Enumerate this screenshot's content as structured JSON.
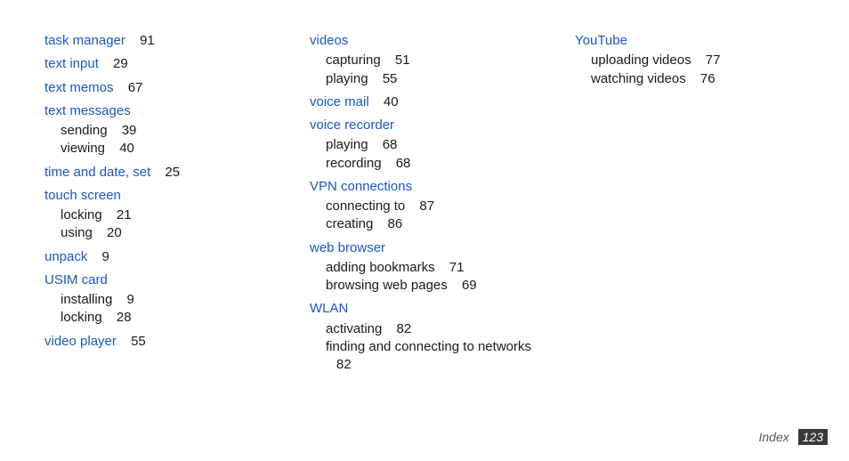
{
  "columns": [
    {
      "entries": [
        {
          "term": "task manager",
          "page": "91"
        },
        {
          "term": "text input",
          "page": "29"
        },
        {
          "term": "text memos",
          "page": "67"
        },
        {
          "term": "text messages",
          "subs": [
            {
              "label": "sending",
              "page": "39"
            },
            {
              "label": "viewing",
              "page": "40"
            }
          ]
        },
        {
          "term": "time and date, set",
          "page": "25"
        },
        {
          "term": "touch screen",
          "subs": [
            {
              "label": "locking",
              "page": "21"
            },
            {
              "label": "using",
              "page": "20"
            }
          ]
        },
        {
          "term": "unpack",
          "page": "9"
        },
        {
          "term": "USIM card",
          "subs": [
            {
              "label": "installing",
              "page": "9"
            },
            {
              "label": "locking",
              "page": "28"
            }
          ]
        },
        {
          "term": "video player",
          "page": "55"
        }
      ]
    },
    {
      "entries": [
        {
          "term": "videos",
          "subs": [
            {
              "label": "capturing",
              "page": "51"
            },
            {
              "label": "playing",
              "page": "55"
            }
          ]
        },
        {
          "term": "voice mail",
          "page": "40"
        },
        {
          "term": "voice recorder",
          "subs": [
            {
              "label": "playing",
              "page": "68"
            },
            {
              "label": "recording",
              "page": "68"
            }
          ]
        },
        {
          "term": "VPN connections",
          "subs": [
            {
              "label": "connecting to",
              "page": "87"
            },
            {
              "label": "creating",
              "page": "86"
            }
          ]
        },
        {
          "term": "web browser",
          "subs": [
            {
              "label": "adding bookmarks",
              "page": "71"
            },
            {
              "label": "browsing web pages",
              "page": "69"
            }
          ]
        },
        {
          "term": "WLAN",
          "subs": [
            {
              "label": "activating",
              "page": "82"
            },
            {
              "label": "finding and connecting to networks",
              "page": "82"
            }
          ]
        }
      ]
    },
    {
      "entries": [
        {
          "term": "YouTube",
          "subs": [
            {
              "label": "uploading videos",
              "page": "77"
            },
            {
              "label": "watching videos",
              "page": "76"
            }
          ]
        }
      ]
    }
  ],
  "footer": {
    "label": "Index",
    "page": "123"
  }
}
